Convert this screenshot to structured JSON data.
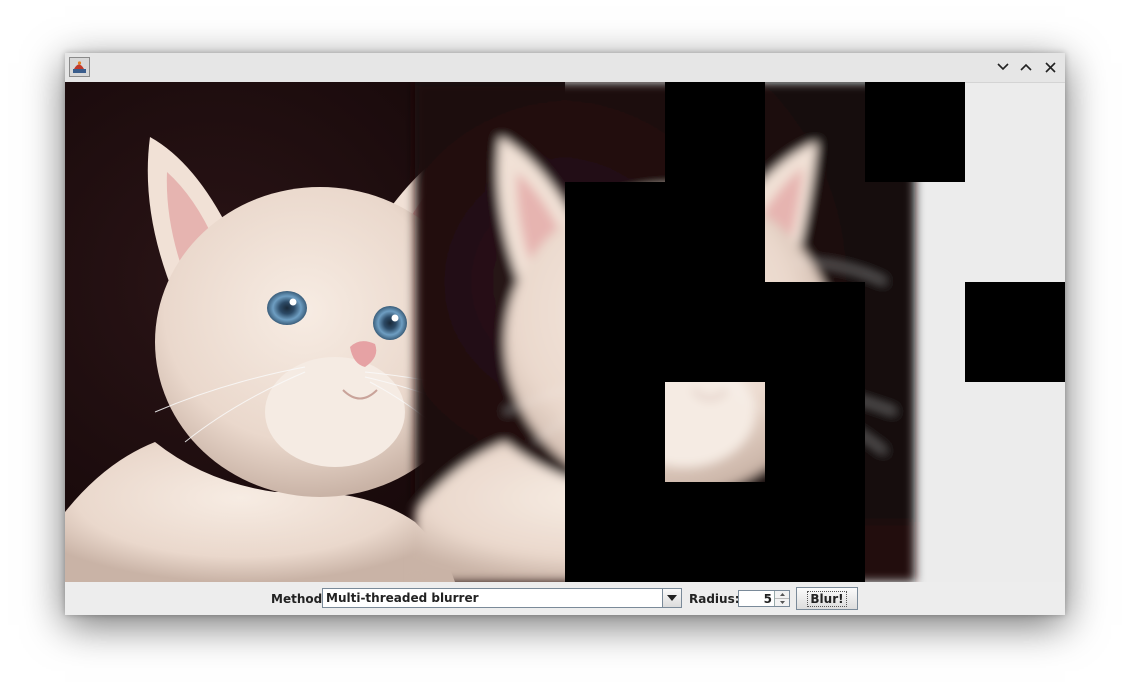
{
  "window": {
    "title": "",
    "buttons": [
      "minimize",
      "maximize",
      "close"
    ]
  },
  "image": {
    "subject": "white kitten on dark background",
    "left_half": "original",
    "right_half": "blurred, partially processed in tiles"
  },
  "controls": {
    "method_label": "Method:",
    "method_value": "Multi-threaded blurrer",
    "radius_label": "Radius:",
    "radius_value": "5",
    "blur_button": "Blur!"
  },
  "icons": {
    "app": "java-cup-icon",
    "minimize": "chevron-down-icon",
    "maximize": "chevron-up-icon",
    "close": "close-icon",
    "dropdown": "triangle-down-icon"
  },
  "colors": {
    "background_dark": "#1c0b0d",
    "fur": "#ecdcd0",
    "eye": "#6e9ec2",
    "nose": "#e6a2a4"
  }
}
